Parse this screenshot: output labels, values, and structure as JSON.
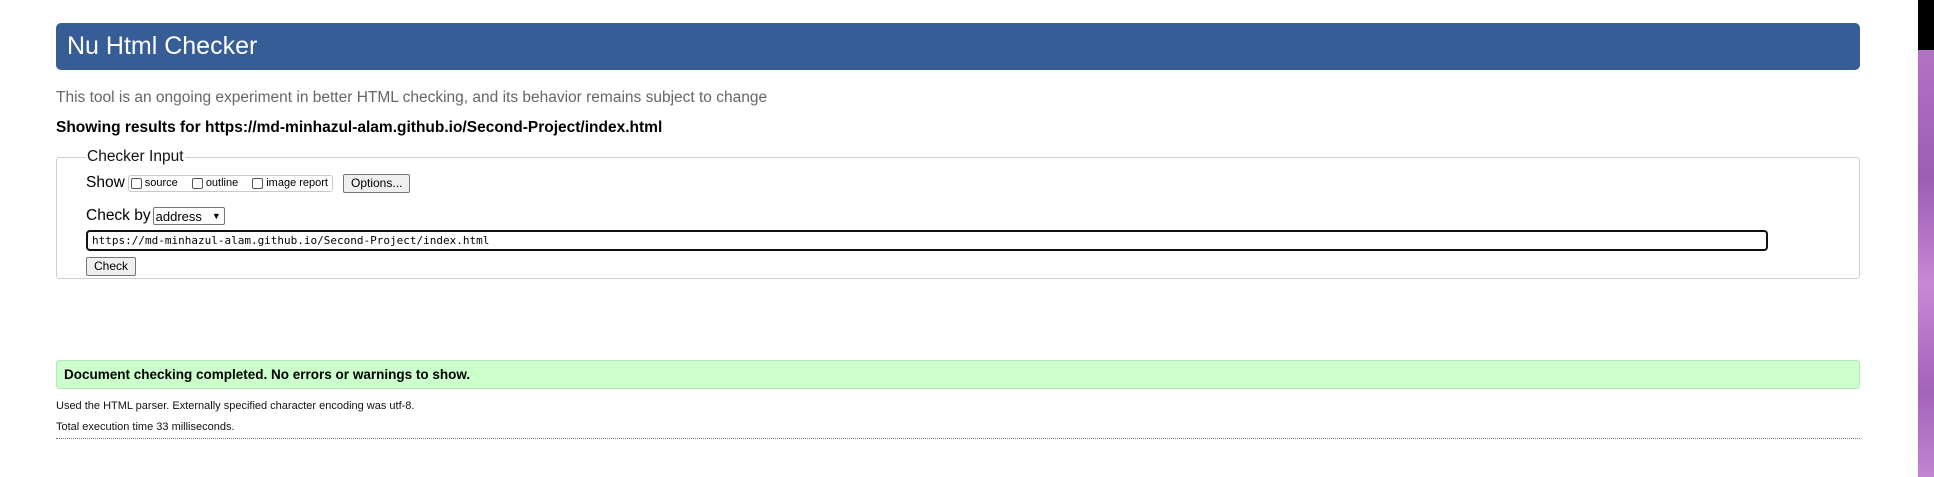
{
  "header": {
    "title": "Nu Html Checker"
  },
  "subtitle": "This tool is an ongoing experiment in better HTML checking, and its behavior remains subject to change",
  "results_for": "Showing results for https://md-minhazul-alam.github.io/Second-Project/index.html",
  "checker_input": {
    "legend": "Checker Input",
    "show_label": "Show",
    "show_options": [
      {
        "label": "source",
        "checked": false
      },
      {
        "label": "outline",
        "checked": false
      },
      {
        "label": "image report",
        "checked": false
      }
    ],
    "options_button": "Options...",
    "check_by_label": "Check by",
    "check_by_value": "address",
    "url_value": "https://md-minhazul-alam.github.io/Second-Project/index.html",
    "check_button": "Check"
  },
  "result": {
    "message": "Document checking completed. No errors or warnings to show.",
    "color": "#ccffcc"
  },
  "details": {
    "parser": "Used the HTML parser. Externally specified character encoding was utf-8.",
    "time": "Total execution time 33 milliseconds."
  },
  "colors": {
    "header_bg": "#365d95",
    "subtitle_text": "#666666"
  }
}
